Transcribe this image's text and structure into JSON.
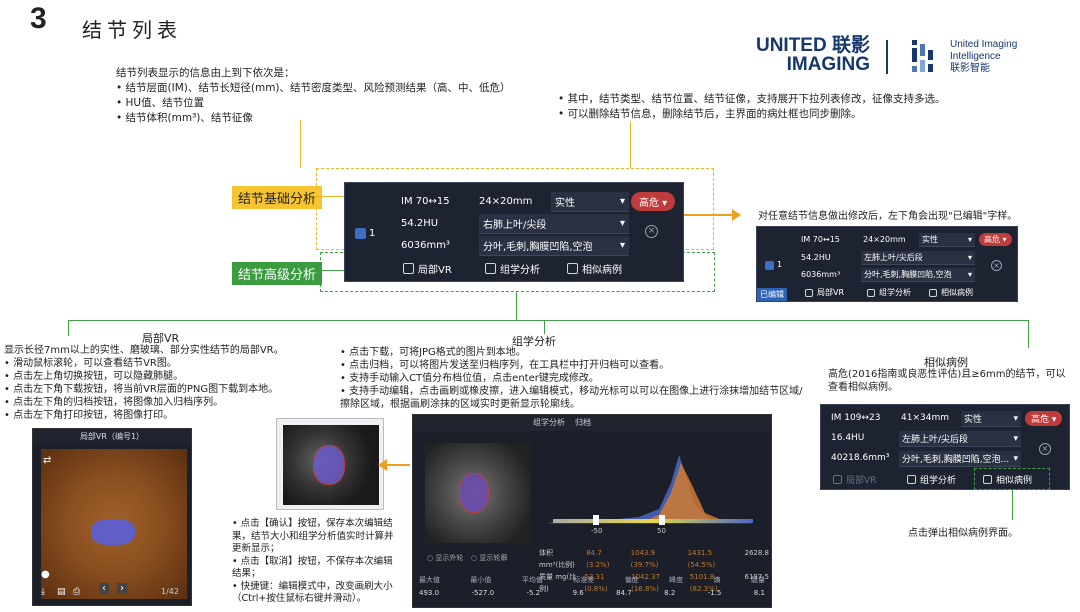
{
  "header": {
    "number": "3",
    "title": "结节列表"
  },
  "logo": {
    "united_line1": "UNITED 联影",
    "united_line2": "IMAGING",
    "ii_line1": "United Imaging",
    "ii_line2": "Intelligence",
    "ii_line3": "联影智能"
  },
  "intro": {
    "lead": "结节列表显示的信息由上到下依次是：",
    "items": [
      "结节层面(IM)、结节长短径(mm)、结节密度类型、风险预测结果（高、中、低危）",
      "HU值、结节位置",
      "结节体积(mm³)、结节征像"
    ]
  },
  "intro_right": {
    "items": [
      "其中，结节类型、结节位置、结节征像，支持展开下拉列表修改，征像支持多选。",
      "可以删除结节信息，删除结节后，主界面的病灶框也同步删除。"
    ]
  },
  "tags": {
    "basic": "结节基础分析",
    "advanced": "结节高级分析"
  },
  "main_panel": {
    "im": "IM 70↔15",
    "size": "24×20mm",
    "density": "实性",
    "risk": "高危",
    "checkbox_index": "1",
    "hu": "54.2HU",
    "position": "右肺上叶/尖段",
    "volume": "6036mm³",
    "sign": "分叶,毛刺,胸膜凹陷,空泡",
    "btn_vr": "局部VR",
    "btn_radiomics": "组学分析",
    "btn_similar": "相似病例"
  },
  "edited_note": "对任意结节信息做出修改后，左下角会出现\"已编辑\"字样。",
  "edited_panel": {
    "im": "IM 70↔15",
    "size": "24×20mm",
    "density": "实性",
    "risk": "高危",
    "checkbox_index": "1",
    "hu": "54.2HU",
    "position": "左肺上叶/尖后段",
    "volume": "6036mm³",
    "sign": "分叶,毛刺,胸膜凹陷,空泡",
    "edited": "已编辑",
    "btn_vr": "局部VR",
    "btn_radiomics": "组学分析",
    "btn_similar": "相似病例"
  },
  "vr": {
    "title": "局部VR",
    "desc": "显示长径7mm以上的实性、磨玻璃、部分实性结节的局部VR。",
    "items": [
      "滑动鼠标滚轮，可以查看结节VR图。",
      "点击左上角切换按钮，可以隐藏肺腿。",
      "点击左下角下载按钮，将当前VR层面的PNG图下载到本地。",
      "点击左下角的归档按钮，将图像加入归档序列。",
      "点击左下角打印按钮，将图像打印。"
    ],
    "window_title": "局部VR（编号1）",
    "page": "1/42"
  },
  "radiomics": {
    "title": "组学分析",
    "items": [
      "点击下载，可将JPG格式的图片到本地。",
      "点击归档，可以将图片发送至归档序列，在工具栏中打开归档可以查看。",
      "支持手动输入CT值分布档位值，点击enter键完成修改。",
      "支持手动编辑，点击画刷或橡皮擦，进入编辑模式，移动光标可以可以在图像上进行涂抹增加结节区域/擦除区域，根据画刷涂抹的区域实时更新显示轮廓线。"
    ],
    "left_notes": [
      "点击【确认】按钮，保存本次编辑结果，结节大小和组学分析值实时计算并更新显示；",
      "点击【取消】按钮，不保存本次编辑结果；",
      "快捷键：编辑模式中，改变画刷大小（Ctrl+按住鼠标右键并滑动）。"
    ],
    "tabs": [
      "组学分析",
      "归档"
    ],
    "slider_left": "-50",
    "slider_right": "50",
    "col_headers": [
      "最大值",
      "最小值",
      "平均值",
      "标准差",
      "偏度",
      "峰度",
      "熵",
      "能量"
    ],
    "row1_label": "体积 mm³(比例)",
    "row1": [
      "84.7 (3.2%)",
      "1043.9 (39.7%)",
      "1431.5 (54.5%)",
      "68.6 (2.6%)",
      "2628.8"
    ],
    "row2_label": "质量 mg(比例)",
    "row2": [
      "53.31 (0.8%)",
      "1042.37 (16.8%)",
      "5101.8 (82.3%)",
      "0.00 (0.0%)",
      "6197.5"
    ],
    "bottom": [
      "493.0",
      "-527.0",
      "-5.2",
      "9.6",
      "84.7",
      "8.2",
      "-1.5",
      "8.1"
    ]
  },
  "similar": {
    "title": "相似病例",
    "desc": "高危(2016指南或良恶性评估)且≥6mm的结节，可以查看相似病例。",
    "im": "IM 109↔23",
    "size": "41×34mm",
    "density": "实性",
    "risk": "高危",
    "hu": "16.4HU",
    "position": "左肺上叶/尖后段",
    "volume": "40218.6mm³",
    "sign": "分叶,毛刺,胸膜凹陷,空泡...",
    "btn_vr": "局部VR",
    "btn_radiomics": "组学分析",
    "btn_similar": "相似病例",
    "note": "点击弹出相似病例界面。"
  },
  "colors": {
    "accent_yellow": "#f6c331",
    "accent_green": "#3a9c3f",
    "risk_red": "#c03b3b",
    "panel_bg": "#1d2331"
  }
}
